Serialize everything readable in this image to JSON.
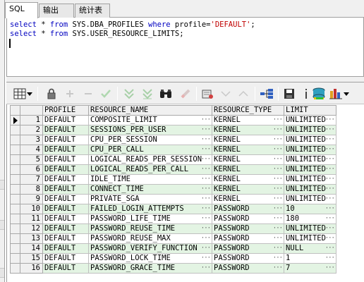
{
  "tabs": [
    {
      "label": "SQL"
    },
    {
      "label": "输出"
    },
    {
      "label": "统计表"
    }
  ],
  "editor": {
    "line1": {
      "kw1": "select",
      "t1": " * ",
      "kw2": "from",
      "t2": " SYS.DBA_PROFILES ",
      "kw3": "where",
      "t3": " profile=",
      "str": "'DEFAULT'",
      "t4": ";"
    },
    "line2": {
      "kw1": "select",
      "t1": " * ",
      "kw2": "from",
      "t2": " SYS.USER_RESOURCE_LIMITS;"
    }
  },
  "colors": {
    "keyword": "#0000c0",
    "string": "#c00000",
    "even_row": "#e3f4e3"
  },
  "toolbar": {
    "icons": [
      "grid-view-icon",
      "dropdown-arrow-icon",
      "lock-icon",
      "add-row-icon",
      "delete-row-icon",
      "post-changes-icon",
      "filter-down-icon",
      "filter-clear-icon",
      "find-binoculars-icon",
      "clear-icon",
      "export-icon",
      "prev-icon",
      "next-icon",
      "tree-view-icon",
      "save-icon",
      "info-icon",
      "export-data-icon",
      "chart-icon"
    ]
  },
  "grid": {
    "columns": [
      "PROFILE",
      "RESOURCE_NAME",
      "RESOURCE_TYPE",
      "LIMIT"
    ],
    "rows": [
      {
        "n": "1",
        "profile": "DEFAULT",
        "resource": "COMPOSITE_LIMIT",
        "type": "KERNEL",
        "limit": "UNLIMITED"
      },
      {
        "n": "2",
        "profile": "DEFAULT",
        "resource": "SESSIONS_PER_USER",
        "type": "KERNEL",
        "limit": "UNLIMITED"
      },
      {
        "n": "3",
        "profile": "DEFAULT",
        "resource": "CPU_PER_SESSION",
        "type": "KERNEL",
        "limit": "UNLIMITED"
      },
      {
        "n": "4",
        "profile": "DEFAULT",
        "resource": "CPU_PER_CALL",
        "type": "KERNEL",
        "limit": "UNLIMITED"
      },
      {
        "n": "5",
        "profile": "DEFAULT",
        "resource": "LOGICAL_READS_PER_SESSION",
        "type": "KERNEL",
        "limit": "UNLIMITED"
      },
      {
        "n": "6",
        "profile": "DEFAULT",
        "resource": "LOGICAL_READS_PER_CALL",
        "type": "KERNEL",
        "limit": "UNLIMITED"
      },
      {
        "n": "7",
        "profile": "DEFAULT",
        "resource": "IDLE_TIME",
        "type": "KERNEL",
        "limit": "UNLIMITED"
      },
      {
        "n": "8",
        "profile": "DEFAULT",
        "resource": "CONNECT_TIME",
        "type": "KERNEL",
        "limit": "UNLIMITED"
      },
      {
        "n": "9",
        "profile": "DEFAULT",
        "resource": "PRIVATE_SGA",
        "type": "KERNEL",
        "limit": "UNLIMITED"
      },
      {
        "n": "10",
        "profile": "DEFAULT",
        "resource": "FAILED_LOGIN_ATTEMPTS",
        "type": "PASSWORD",
        "limit": "10"
      },
      {
        "n": "11",
        "profile": "DEFAULT",
        "resource": "PASSWORD_LIFE_TIME",
        "type": "PASSWORD",
        "limit": "180"
      },
      {
        "n": "12",
        "profile": "DEFAULT",
        "resource": "PASSWORD_REUSE_TIME",
        "type": "PASSWORD",
        "limit": "UNLIMITED"
      },
      {
        "n": "13",
        "profile": "DEFAULT",
        "resource": "PASSWORD_REUSE_MAX",
        "type": "PASSWORD",
        "limit": "UNLIMITED"
      },
      {
        "n": "14",
        "profile": "DEFAULT",
        "resource": "PASSWORD_VERIFY_FUNCTION",
        "type": "PASSWORD",
        "limit": "NULL"
      },
      {
        "n": "15",
        "profile": "DEFAULT",
        "resource": "PASSWORD_LOCK_TIME",
        "type": "PASSWORD",
        "limit": "1"
      },
      {
        "n": "16",
        "profile": "DEFAULT",
        "resource": "PASSWORD_GRACE_TIME",
        "type": "PASSWORD",
        "limit": "7"
      }
    ]
  }
}
